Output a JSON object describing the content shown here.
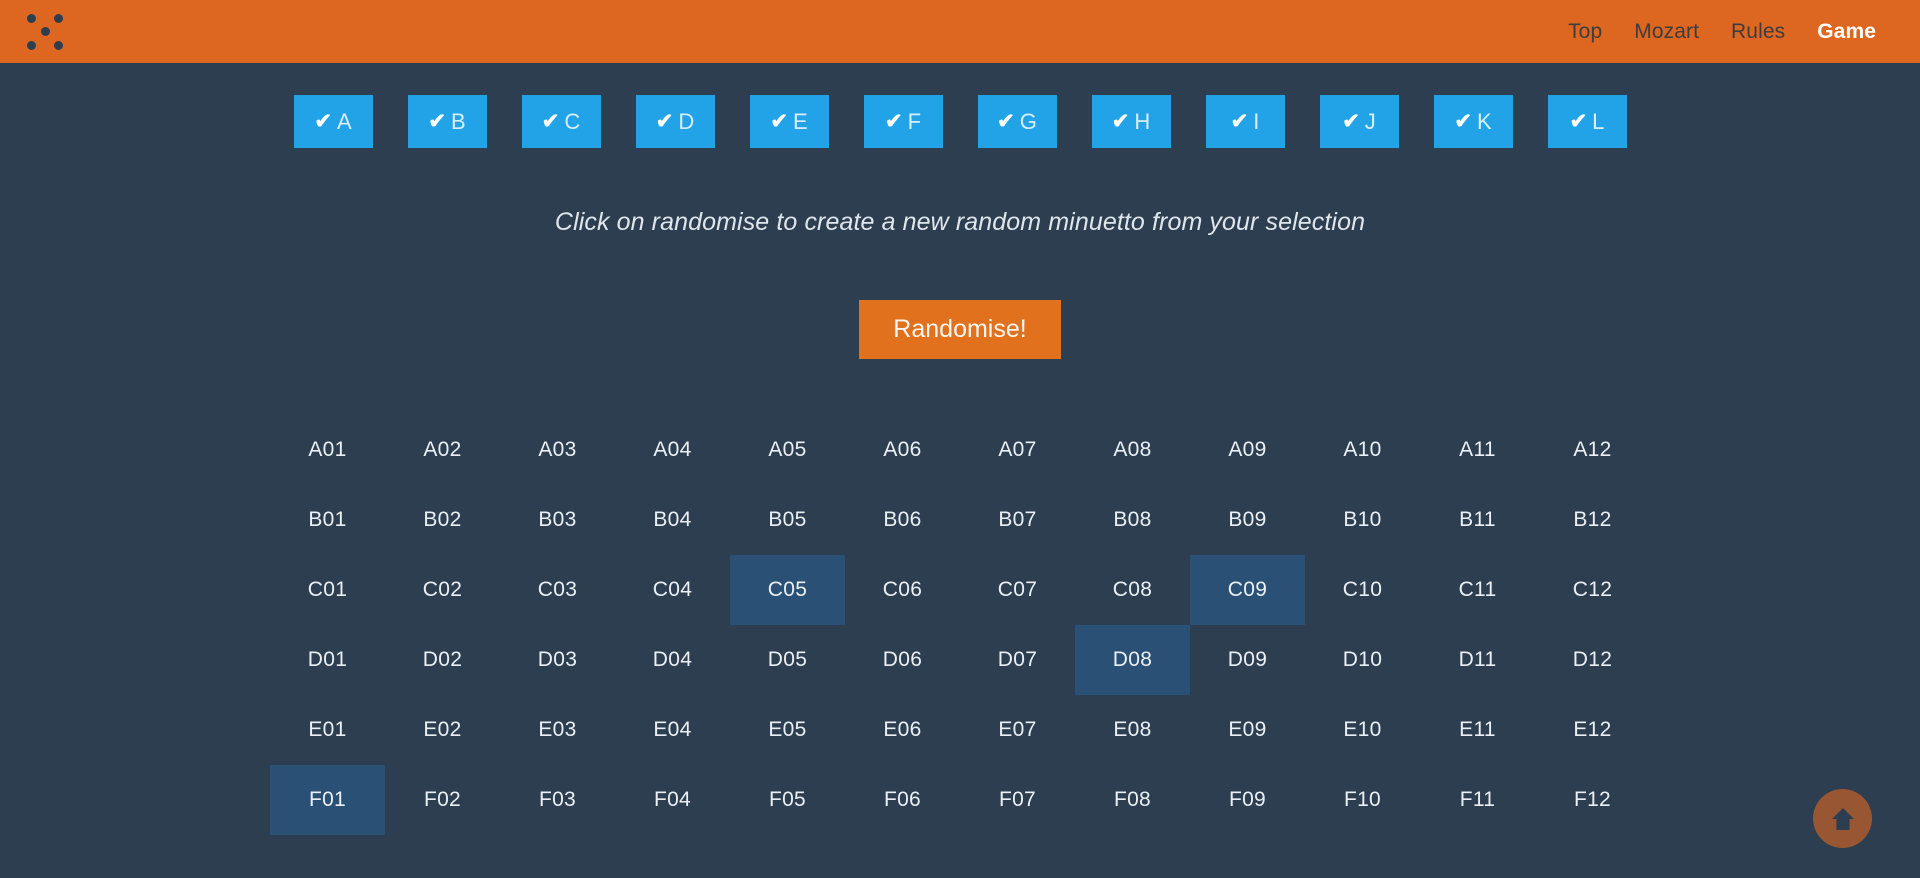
{
  "navbar": {
    "brand_icon": "dice-five-logo-icon",
    "links": [
      {
        "label": "Top",
        "active": false
      },
      {
        "label": "Mozart",
        "active": false
      },
      {
        "label": "Rules",
        "active": false
      },
      {
        "label": "Game",
        "active": true
      }
    ]
  },
  "selector": {
    "check_glyph": "✔",
    "items": [
      {
        "label": "A",
        "checked": true
      },
      {
        "label": "B",
        "checked": true
      },
      {
        "label": "C",
        "checked": true
      },
      {
        "label": "D",
        "checked": true
      },
      {
        "label": "E",
        "checked": true
      },
      {
        "label": "F",
        "checked": true
      },
      {
        "label": "G",
        "checked": true
      },
      {
        "label": "H",
        "checked": true
      },
      {
        "label": "I",
        "checked": true
      },
      {
        "label": "J",
        "checked": true
      },
      {
        "label": "K",
        "checked": true
      },
      {
        "label": "L",
        "checked": true
      }
    ]
  },
  "hint": "Click on randomise to create a new random minuetto from your selection",
  "randomise_button": "Randomise!",
  "grid": {
    "rows": [
      {
        "letter": "A",
        "cells": [
          "A01",
          "A02",
          "A03",
          "A04",
          "A05",
          "A06",
          "A07",
          "A08",
          "A09",
          "A10",
          "A11",
          "A12"
        ]
      },
      {
        "letter": "B",
        "cells": [
          "B01",
          "B02",
          "B03",
          "B04",
          "B05",
          "B06",
          "B07",
          "B08",
          "B09",
          "B10",
          "B11",
          "B12"
        ]
      },
      {
        "letter": "C",
        "cells": [
          "C01",
          "C02",
          "C03",
          "C04",
          "C05",
          "C06",
          "C07",
          "C08",
          "C09",
          "C10",
          "C11",
          "C12"
        ]
      },
      {
        "letter": "D",
        "cells": [
          "D01",
          "D02",
          "D03",
          "D04",
          "D05",
          "D06",
          "D07",
          "D08",
          "D09",
          "D10",
          "D11",
          "D12"
        ]
      },
      {
        "letter": "E",
        "cells": [
          "E01",
          "E02",
          "E03",
          "E04",
          "E05",
          "E06",
          "E07",
          "E08",
          "E09",
          "E10",
          "E11",
          "E12"
        ]
      },
      {
        "letter": "F",
        "cells": [
          "F01",
          "F02",
          "F03",
          "F04",
          "F05",
          "F06",
          "F07",
          "F08",
          "F09",
          "F10",
          "F11",
          "F12"
        ]
      }
    ],
    "selected": [
      "C05",
      "C09",
      "D08",
      "F01"
    ]
  },
  "scroll_top": {
    "icon": "arrow-up-circle-icon",
    "title": "Back to top"
  },
  "colors": {
    "brand_orange": "#dd6620",
    "button_orange": "#e2711d",
    "background": "#2c3e50",
    "checkbox_blue": "#22a3e8",
    "cell_selected": "#2a5075"
  }
}
